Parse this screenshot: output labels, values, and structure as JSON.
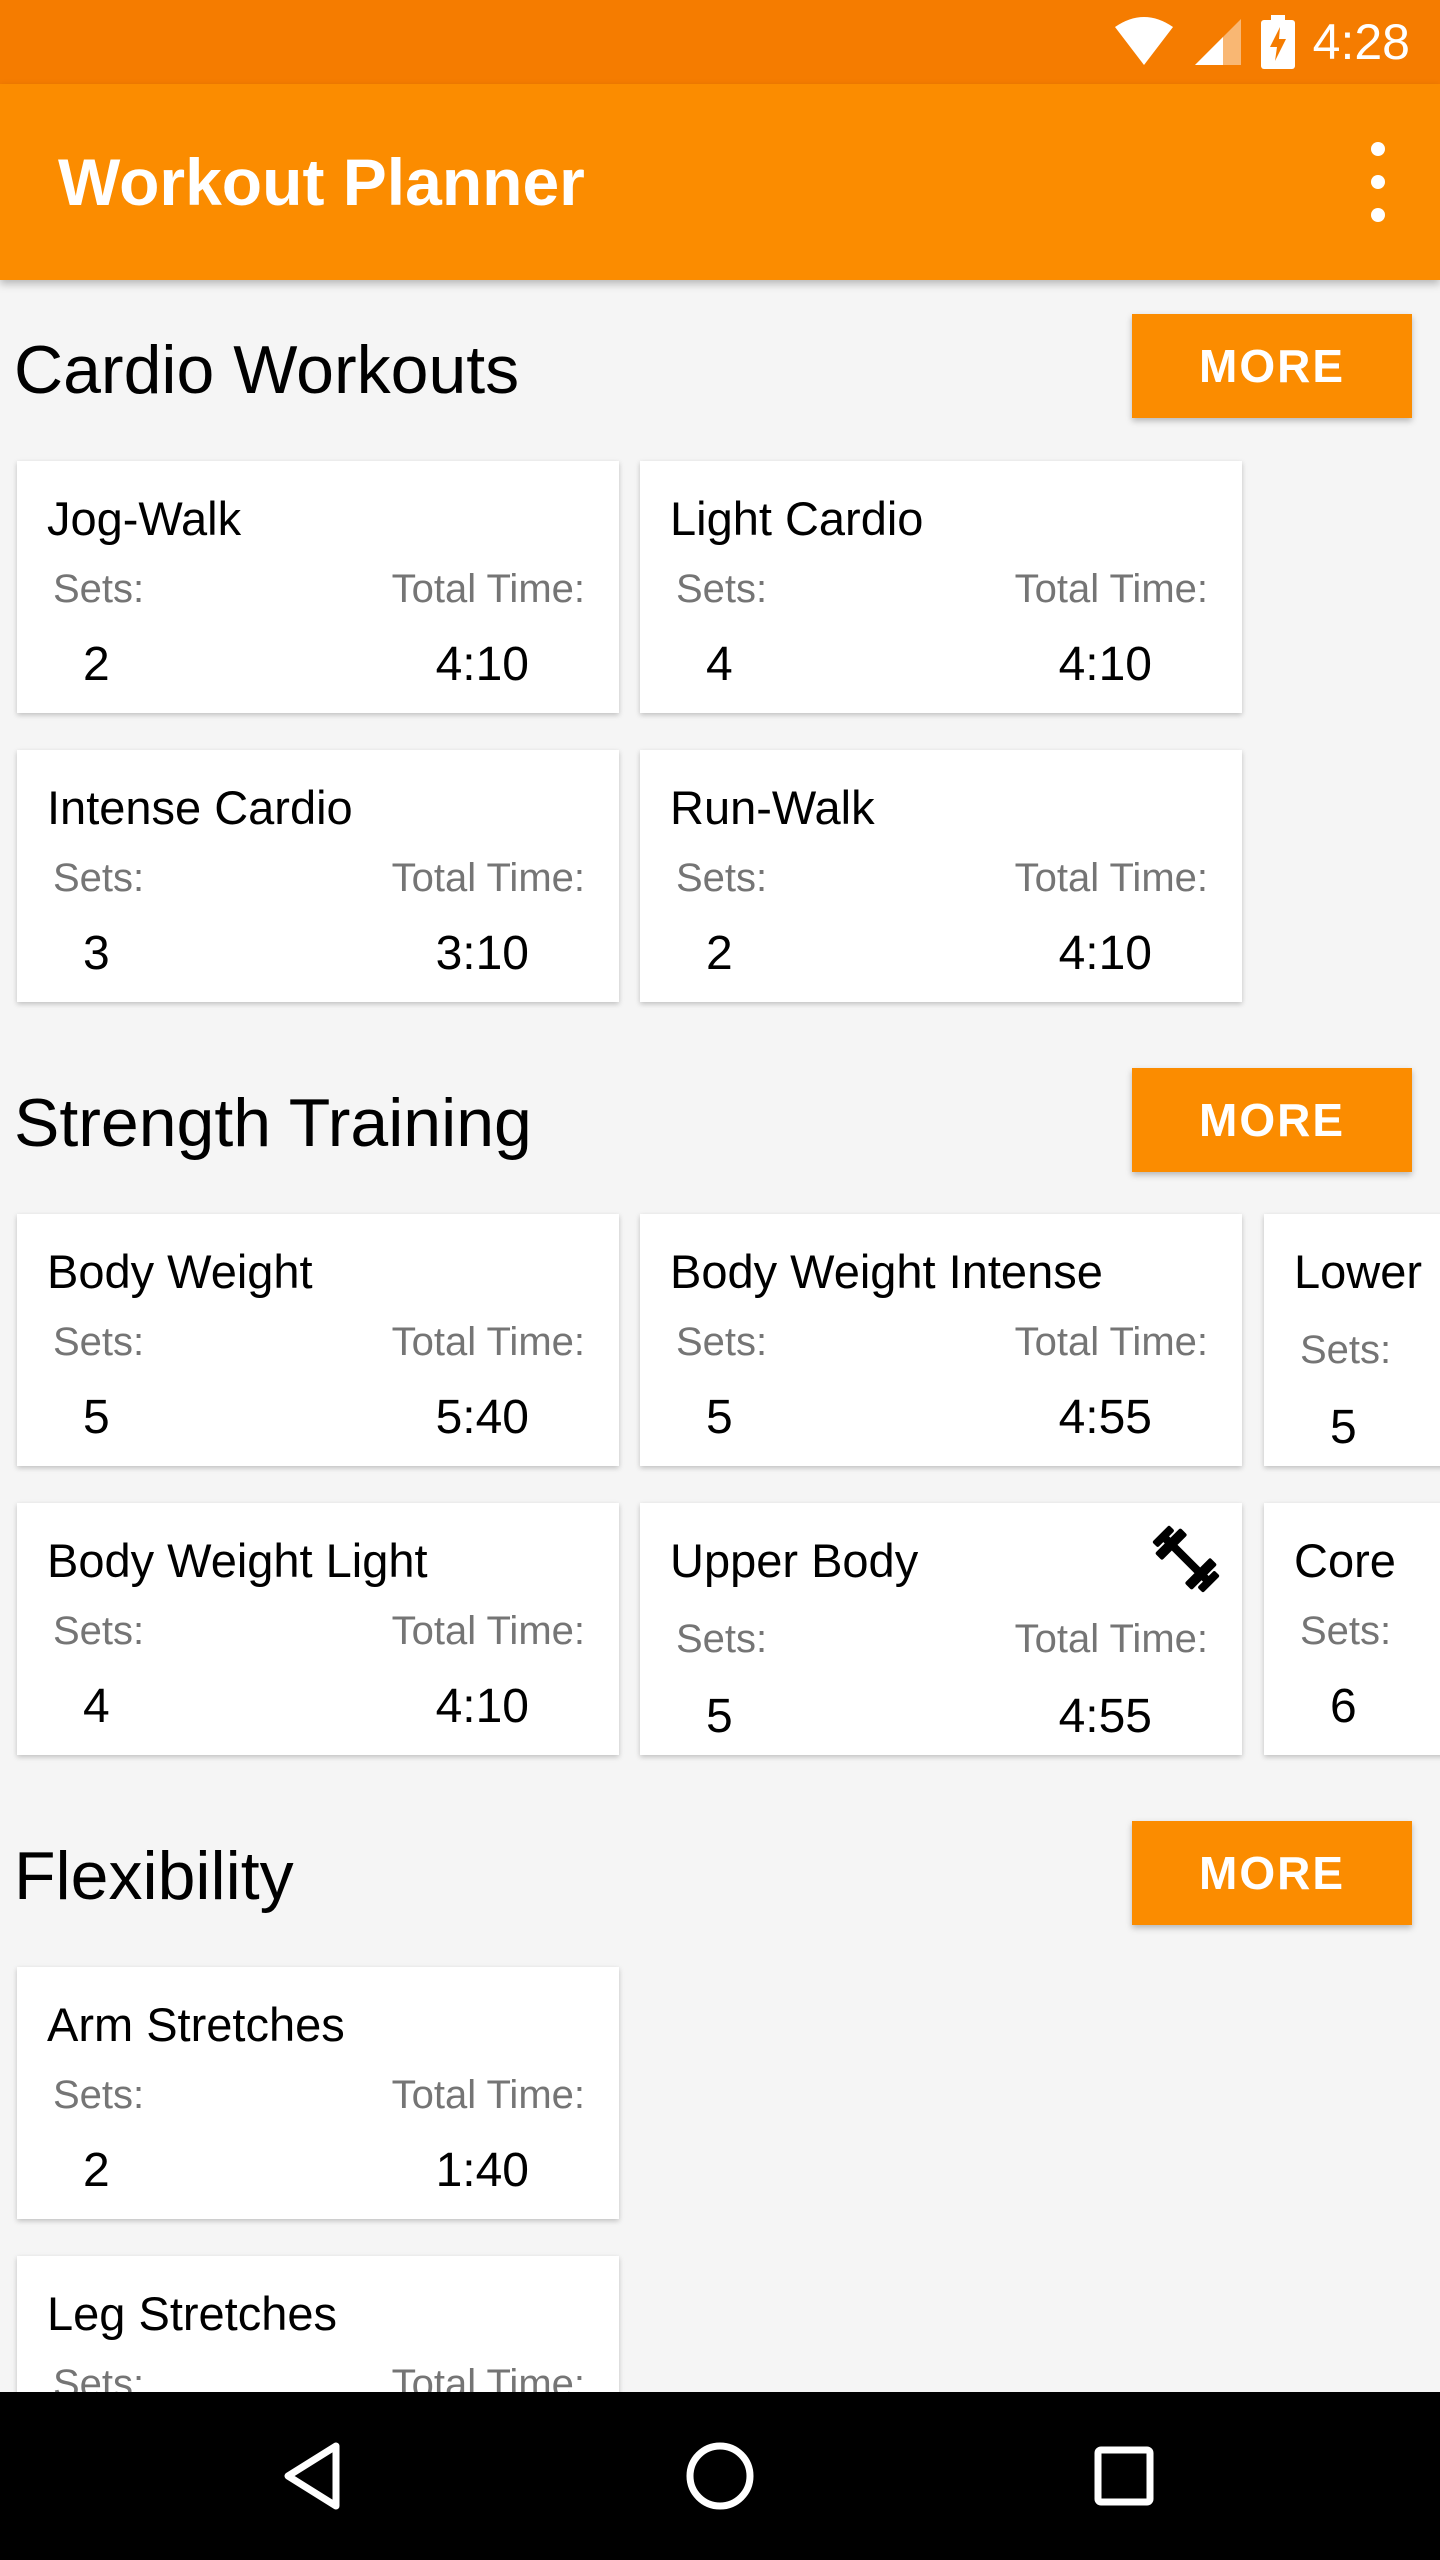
{
  "status_bar": {
    "time": "4:28"
  },
  "app_bar": {
    "title": "Workout Planner",
    "menu_icon": "more-vert-icon"
  },
  "sections": [
    {
      "title": "Cardio Workouts",
      "more_label": "MORE",
      "cards": [
        {
          "title": "Jog-Walk",
          "sets_label": "Sets:",
          "time_label": "Total Time:",
          "sets": "2",
          "time": "4:10"
        },
        {
          "title": "Light Cardio",
          "sets_label": "Sets:",
          "time_label": "Total Time:",
          "sets": "4",
          "time": "4:10"
        },
        {
          "title": "Intense Cardio",
          "sets_label": "Sets:",
          "time_label": "Total Time:",
          "sets": "3",
          "time": "3:10"
        },
        {
          "title": "Run-Walk",
          "sets_label": "Sets:",
          "time_label": "Total Time:",
          "sets": "2",
          "time": "4:10"
        }
      ]
    },
    {
      "title": "Strength Training",
      "more_label": "MORE",
      "cards": [
        {
          "title": "Body Weight",
          "sets_label": "Sets:",
          "time_label": "Total Time:",
          "sets": "5",
          "time": "5:40"
        },
        {
          "title": "Body Weight Intense",
          "sets_label": "Sets:",
          "time_label": "Total Time:",
          "sets": "5",
          "time": "4:55"
        },
        {
          "title": "Lower",
          "sets_label": "Sets:",
          "sets": "5"
        },
        {
          "title": "Body Weight Light",
          "sets_label": "Sets:",
          "time_label": "Total Time:",
          "sets": "4",
          "time": "4:10"
        },
        {
          "title": "Upper Body",
          "sets_label": "Sets:",
          "time_label": "Total Time:",
          "sets": "5",
          "time": "4:55",
          "icon": "dumbbell-icon"
        },
        {
          "title": "Core",
          "sets_label": "Sets:",
          "sets": "6"
        }
      ]
    },
    {
      "title": "Flexibility",
      "more_label": "MORE",
      "cards": [
        {
          "title": "Arm Stretches",
          "sets_label": "Sets:",
          "time_label": "Total Time:",
          "sets": "2",
          "time": "1:40"
        },
        {
          "title": "Leg Stretches",
          "sets_label": "Sets:",
          "time_label": "Total Time:"
        }
      ]
    }
  ],
  "nav_bar": {
    "back_icon": "back-triangle-icon",
    "home_icon": "home-circle-icon",
    "recents_icon": "recents-square-icon"
  },
  "colors": {
    "status_bar": "#f57c00",
    "app_bar": "#fb8c00",
    "accent": "#fb8c00",
    "background": "#f5f5f5"
  }
}
